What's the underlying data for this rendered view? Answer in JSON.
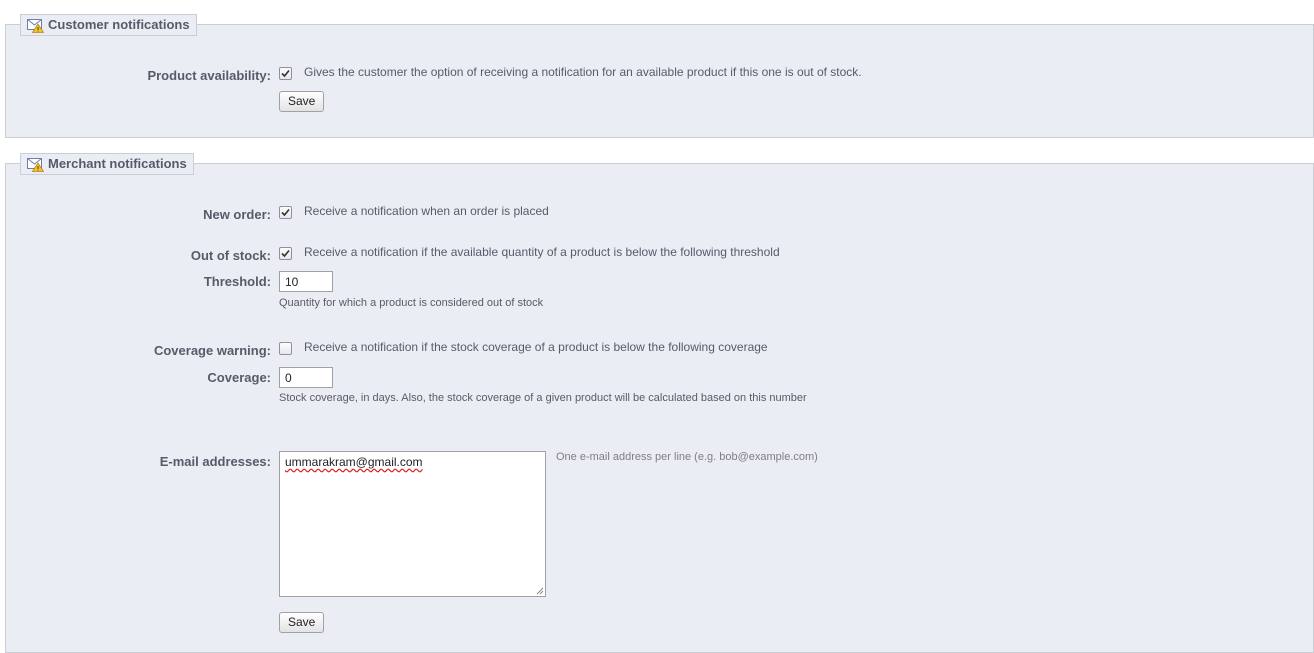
{
  "customer": {
    "legend": "Customer notifications",
    "product_availability": {
      "label": "Product availability:",
      "checked": true,
      "description": "Gives the customer the option of receiving a notification for an available product if this one is out of stock."
    },
    "save_label": "Save"
  },
  "merchant": {
    "legend": "Merchant notifications",
    "new_order": {
      "label": "New order:",
      "checked": true,
      "description": "Receive a notification when an order is placed"
    },
    "out_of_stock": {
      "label": "Out of stock:",
      "checked": true,
      "description": "Receive a notification if the available quantity of a product is below the following threshold"
    },
    "threshold": {
      "label": "Threshold:",
      "value": "10",
      "hint": "Quantity for which a product is considered out of stock"
    },
    "coverage_warning": {
      "label": "Coverage warning:",
      "checked": false,
      "description": "Receive a notification if the stock coverage of a product is below the following coverage"
    },
    "coverage": {
      "label": "Coverage:",
      "value": "0",
      "hint": "Stock coverage, in days. Also, the stock coverage of a given product will be calculated based on this number"
    },
    "emails": {
      "label": "E-mail addresses:",
      "value": "ummarakram@gmail.com",
      "hint": "One e-mail address per line (e.g. bob@example.com)"
    },
    "save_label": "Save"
  },
  "icons": {
    "legend_icon": "email-warning-icon",
    "checkbox_check": "checkmark-icon"
  },
  "colors": {
    "panel_bg": "#ebedf4",
    "panel_border": "#ccced7",
    "label_text": "#585a69"
  }
}
